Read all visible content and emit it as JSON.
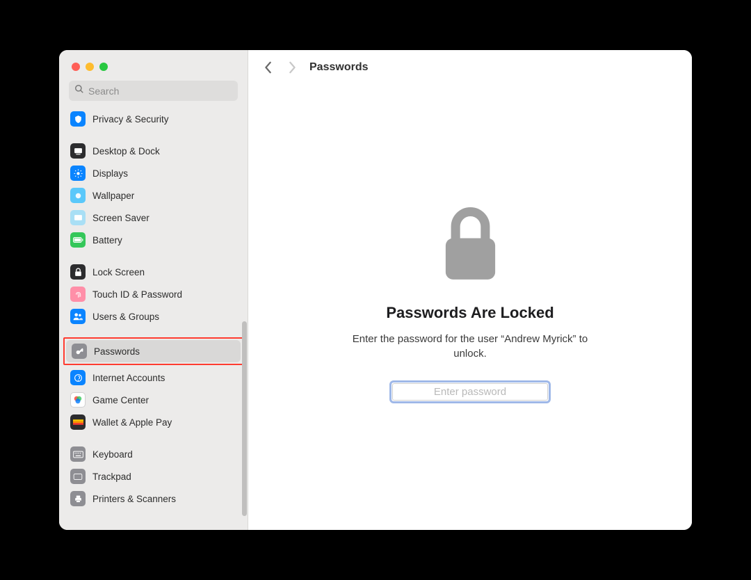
{
  "window": {
    "search_placeholder": "Search"
  },
  "header": {
    "title": "Passwords"
  },
  "sidebar": {
    "groups": [
      {
        "items": [
          {
            "label": "Privacy & Security"
          }
        ]
      },
      {
        "items": [
          {
            "label": "Desktop & Dock"
          },
          {
            "label": "Displays"
          },
          {
            "label": "Wallpaper"
          },
          {
            "label": "Screen Saver"
          },
          {
            "label": "Battery"
          }
        ]
      },
      {
        "items": [
          {
            "label": "Lock Screen"
          },
          {
            "label": "Touch ID & Password"
          },
          {
            "label": "Users & Groups"
          }
        ]
      },
      {
        "items": [
          {
            "label": "Passwords"
          },
          {
            "label": "Internet Accounts"
          },
          {
            "label": "Game Center"
          },
          {
            "label": "Wallet & Apple Pay"
          }
        ]
      },
      {
        "items": [
          {
            "label": "Keyboard"
          },
          {
            "label": "Trackpad"
          },
          {
            "label": "Printers & Scanners"
          }
        ]
      }
    ]
  },
  "main": {
    "locked_title": "Passwords Are Locked",
    "locked_subtitle": "Enter the password for the user “Andrew Myrick” to unlock.",
    "password_placeholder": "Enter password"
  }
}
